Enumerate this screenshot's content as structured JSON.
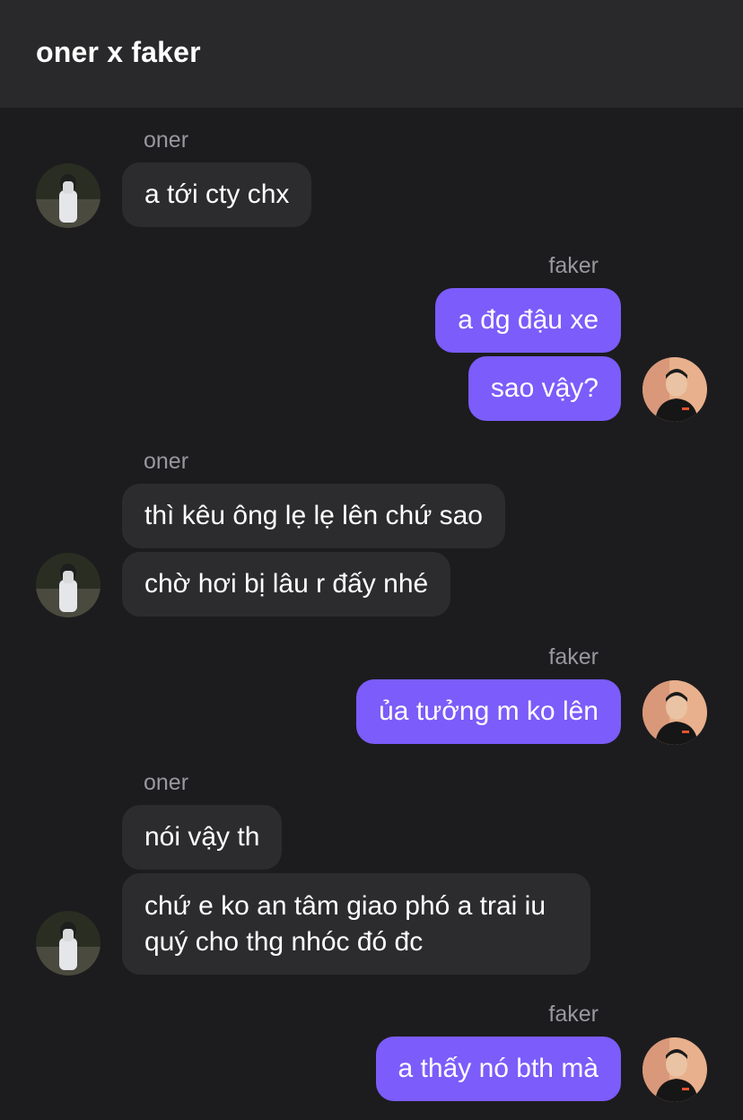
{
  "header": {
    "title": "oner x faker"
  },
  "messages": [
    {
      "sender": "oner",
      "texts": [
        "a tới cty chx"
      ]
    },
    {
      "sender": "faker",
      "texts": [
        "a đg đậu xe",
        "sao vậy?"
      ]
    },
    {
      "sender": "oner",
      "texts": [
        "thì kêu ông lẹ lẹ lên chứ sao",
        "chờ hơi bị lâu r đấy nhé"
      ]
    },
    {
      "sender": "faker",
      "texts": [
        "ủa tưởng m ko lên"
      ]
    },
    {
      "sender": "oner",
      "texts": [
        "nói vậy th",
        "chứ e ko an tâm giao phó a trai iu quý cho thg nhóc đó đc"
      ]
    },
    {
      "sender": "faker",
      "texts": [
        "a thấy nó bth mà"
      ]
    }
  ],
  "colors": {
    "background": "#1c1c1e",
    "header": "#29292b",
    "incoming_bubble": "#2c2c2e",
    "outgoing_bubble": "#7c5cfa",
    "sender_name": "#98989d"
  },
  "icons": {
    "oner_avatar": "oner-avatar-photo",
    "faker_avatar": "faker-avatar-photo"
  }
}
